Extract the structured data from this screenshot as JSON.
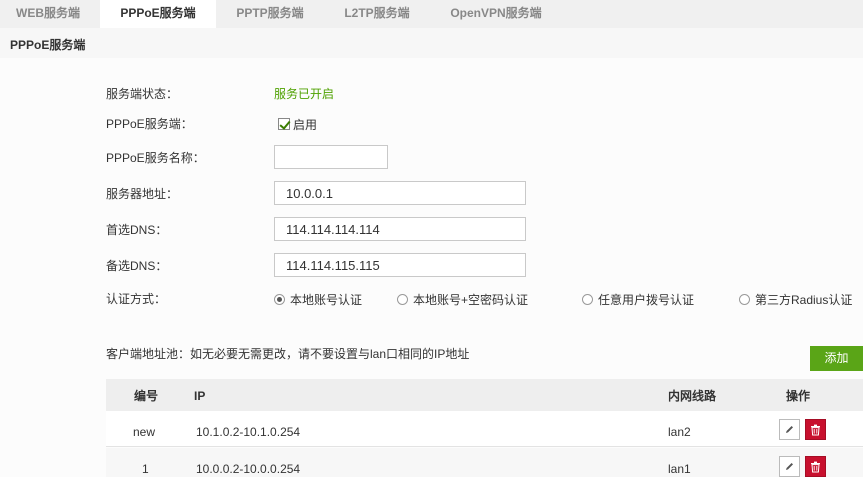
{
  "tabs": [
    {
      "label": "WEB服务端",
      "active": false
    },
    {
      "label": "PPPoE服务端",
      "active": true
    },
    {
      "label": "PPTP服务端",
      "active": false
    },
    {
      "label": "L2TP服务端",
      "active": false
    },
    {
      "label": "OpenVPN服务端",
      "active": false
    }
  ],
  "section_title": "PPPoE服务端",
  "form": {
    "status_label": "服务端状态：",
    "status_value": "服务已开启",
    "status_color": "#4ea100",
    "enable_label": "PPPoE服务端：",
    "enable_checkbox_label": "启用",
    "enable_checked": true,
    "service_name_label": "PPPoE服务名称：",
    "service_name_value": "",
    "server_addr_label": "服务器地址：",
    "server_addr_value": "10.0.0.1",
    "dns1_label": "首选DNS：",
    "dns1_value": "114.114.114.114",
    "dns2_label": "备选DNS：",
    "dns2_value": "114.114.115.115",
    "auth_label": "认证方式：",
    "auth_options": [
      {
        "label": "本地账号认证",
        "selected": true
      },
      {
        "label": "本地账号+空密码认证",
        "selected": false
      },
      {
        "label": "任意用户拨号认证",
        "selected": false
      },
      {
        "label": "第三方Radius认证",
        "selected": false
      }
    ]
  },
  "pool": {
    "note": "客户端地址池：如无必要无需更改，请不要设置与lan口相同的IP地址",
    "add_label": "添加",
    "add_color": "#5aa517",
    "columns": [
      "编号",
      "IP",
      "内网线路",
      "操作"
    ],
    "rows": [
      {
        "id": "new",
        "ip": "10.1.0.2-10.1.0.254",
        "line": "lan2"
      },
      {
        "id": "1",
        "ip": "10.0.0.2-10.0.0.254",
        "line": "lan1"
      }
    ],
    "delete_color": "#c8102e"
  }
}
